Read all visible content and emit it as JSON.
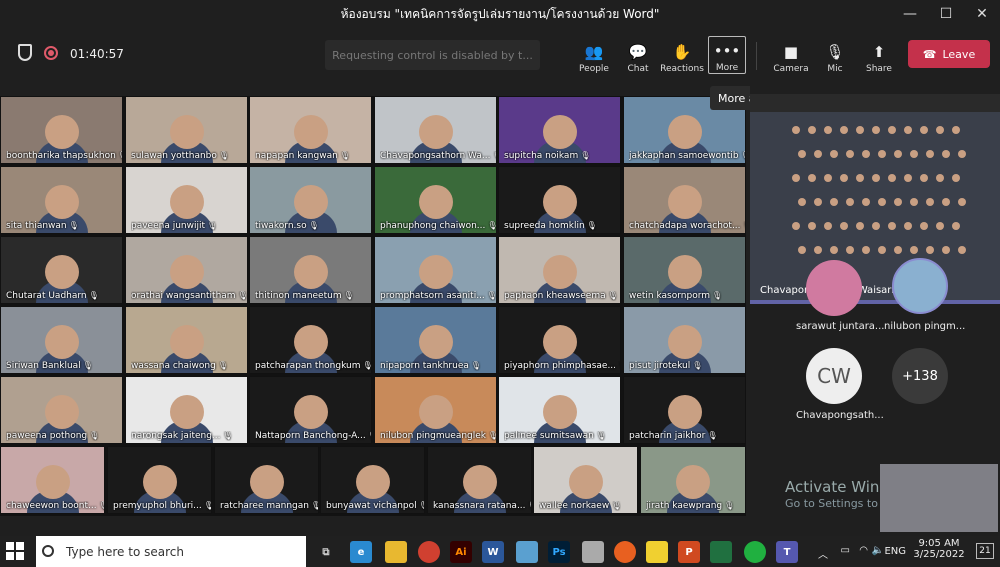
{
  "window": {
    "title": "ห้องอบรม \"เทคนิคการจัดรูปเล่มรายงาน/โครงงานด้วย Word\""
  },
  "meeting": {
    "timer": "01:40:57",
    "request_control": "Requesting control is disabled by t...",
    "tooltip": "More actions"
  },
  "toolbar": {
    "people": "People",
    "chat": "Chat",
    "reactions": "Reactions",
    "more": "More",
    "camera": "Camera",
    "mic": "Mic",
    "share": "Share",
    "leave": "Leave"
  },
  "participants": [
    {
      "name": "boontharika thapsukhon",
      "bg": "#8a7a70"
    },
    {
      "name": "sulawan yotthanbo",
      "bg": "#b8a898"
    },
    {
      "name": "napapan kangwan",
      "bg": "#c5b3a5"
    },
    {
      "name": "Chavapongsathorn Wa...",
      "bg": "#c0c4c8"
    },
    {
      "name": "supitcha noikam",
      "bg": "#5a3a8a"
    },
    {
      "name": "jakkaphan samoewontib",
      "bg": "#6a8aa5"
    },
    {
      "name": "sita thianwan",
      "bg": "#9a8878"
    },
    {
      "name": "paveena junwijit",
      "bg": "#d8d4d0"
    },
    {
      "name": "tiwakorn.so",
      "bg": "#8a9aa0"
    },
    {
      "name": "phanuphong chaiwon...",
      "bg": "#3a6a3a"
    },
    {
      "name": "supreeda homklin",
      "bg": "#1a1a1a"
    },
    {
      "name": "chatchadapa worachot...",
      "bg": "#9a8878"
    },
    {
      "name": "Chutarat Uadharn",
      "bg": "#2a2a2a"
    },
    {
      "name": "orathai wangsantitham",
      "bg": "#b0a8a0"
    },
    {
      "name": "thitinon maneetum",
      "bg": "#7a7a7a"
    },
    {
      "name": "promphatsorn asaniti...",
      "bg": "#8aa0b0"
    },
    {
      "name": "paphaon kheawseema",
      "bg": "#c0b8b0"
    },
    {
      "name": "wetin kasornporm",
      "bg": "#5a6a6a"
    },
    {
      "name": "Siriwan Banklual",
      "bg": "#8a9098"
    },
    {
      "name": "wassana chaiwong",
      "bg": "#b8a890"
    },
    {
      "name": "patcharapan thongkum",
      "bg": "#1a1a1a"
    },
    {
      "name": "nipaporn tankhruea",
      "bg": "#5a7a9a"
    },
    {
      "name": "piyaphorn phimphasae...",
      "bg": "#1a1a1a"
    },
    {
      "name": "pisut jirotekul",
      "bg": "#8a9aa8"
    },
    {
      "name": "paweena pothong",
      "bg": "#b0a090"
    },
    {
      "name": "narongsak jaiteng...",
      "bg": "#e8e8e8"
    },
    {
      "name": "Nattaporn Banchong-A...",
      "bg": "#1a1a1a"
    },
    {
      "name": "nilubon pingmueanglek",
      "bg": "#c88a5a"
    },
    {
      "name": "palinee sumitsawan",
      "bg": "#e0e4e8"
    },
    {
      "name": "patcharin jaikhor",
      "bg": "#1a1a1a"
    },
    {
      "name": "chaweewon boont...",
      "bg": "#c8a8a8"
    },
    {
      "name": "premyuphol bhuri...",
      "bg": "#1a1a1a"
    },
    {
      "name": "ratcharee manngan",
      "bg": "#1a1a1a"
    },
    {
      "name": "bunyawat vichanpol",
      "bg": "#1a1a1a"
    },
    {
      "name": "kanassnara ratana...",
      "bg": "#1a1a1a"
    },
    {
      "name": "wallee norkaew",
      "bg": "#d0ccc8"
    },
    {
      "name": "jirath kaewprang",
      "bg": "#8a9888"
    }
  ],
  "stage": {
    "name": "Chavapongsathorn Waisarikarm"
  },
  "side_avatars": [
    {
      "name": "sarawut juntara...",
      "bg": "#d07aa0"
    },
    {
      "name": "nilubon pingm...",
      "bg": "#8ab0d0"
    },
    {
      "name": "Chavapongsath...",
      "initials": "CW"
    },
    {
      "more": "+138"
    }
  ],
  "watermark": {
    "line1": "Activate Windows",
    "line2": "Go to Settings to activate Windows."
  },
  "taskbar": {
    "search": "Type here to search",
    "time": "9:05 AM",
    "date": "3/25/2022",
    "lang": "ENG",
    "badge": "21"
  }
}
